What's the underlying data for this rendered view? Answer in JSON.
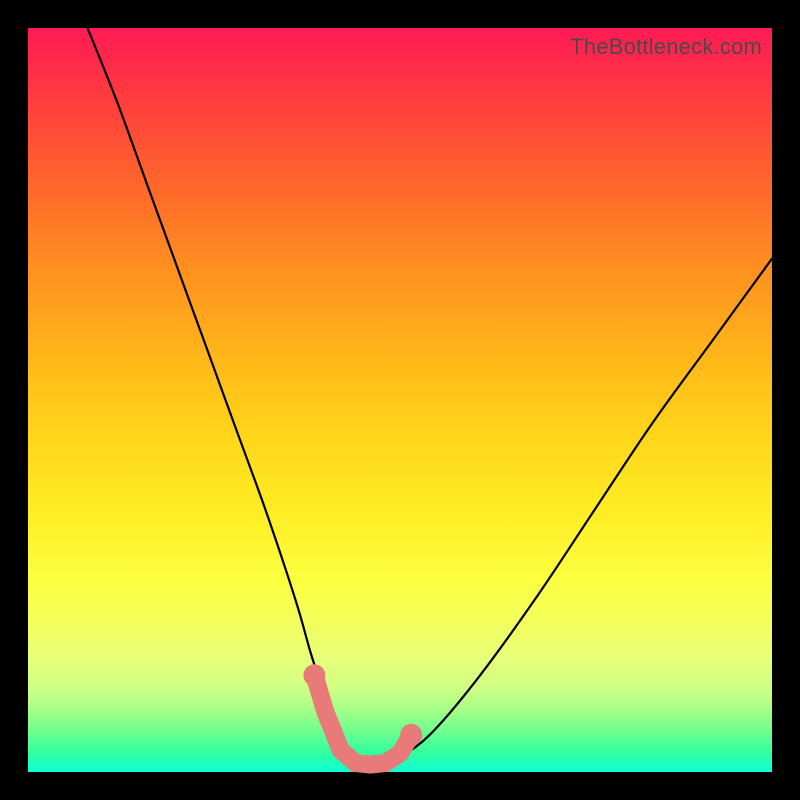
{
  "watermark": "TheBottleneck.com",
  "chart_data": {
    "type": "line",
    "title": "",
    "xlabel": "",
    "ylabel": "",
    "xlim": [
      0,
      100
    ],
    "ylim": [
      0,
      100
    ],
    "series": [
      {
        "name": "curve",
        "x": [
          8,
          12,
          16,
          20,
          24,
          28,
          32,
          36,
          38,
          40,
          42,
          44,
          46,
          48,
          50,
          54,
          60,
          68,
          76,
          84,
          92,
          100
        ],
        "y": [
          100,
          90,
          79,
          68,
          57,
          46,
          35,
          23,
          16,
          10,
          5,
          2,
          1,
          1,
          2,
          5,
          12,
          23,
          35,
          47,
          58,
          69
        ]
      }
    ],
    "markers": {
      "name": "trough-markers",
      "color": "#e97a7a",
      "x": [
        38.5,
        40,
        42,
        44,
        46,
        48,
        50,
        51.5
      ],
      "y": [
        13,
        8,
        3,
        1.2,
        1,
        1.2,
        2.5,
        5
      ]
    },
    "gradient_stops": [
      {
        "pos": 0,
        "color": "#ff1a55"
      },
      {
        "pos": 0.35,
        "color": "#ff9a1f"
      },
      {
        "pos": 0.65,
        "color": "#ffe81f"
      },
      {
        "pos": 0.9,
        "color": "#b8ff70"
      },
      {
        "pos": 1.0,
        "color": "#10ffc8"
      }
    ]
  }
}
